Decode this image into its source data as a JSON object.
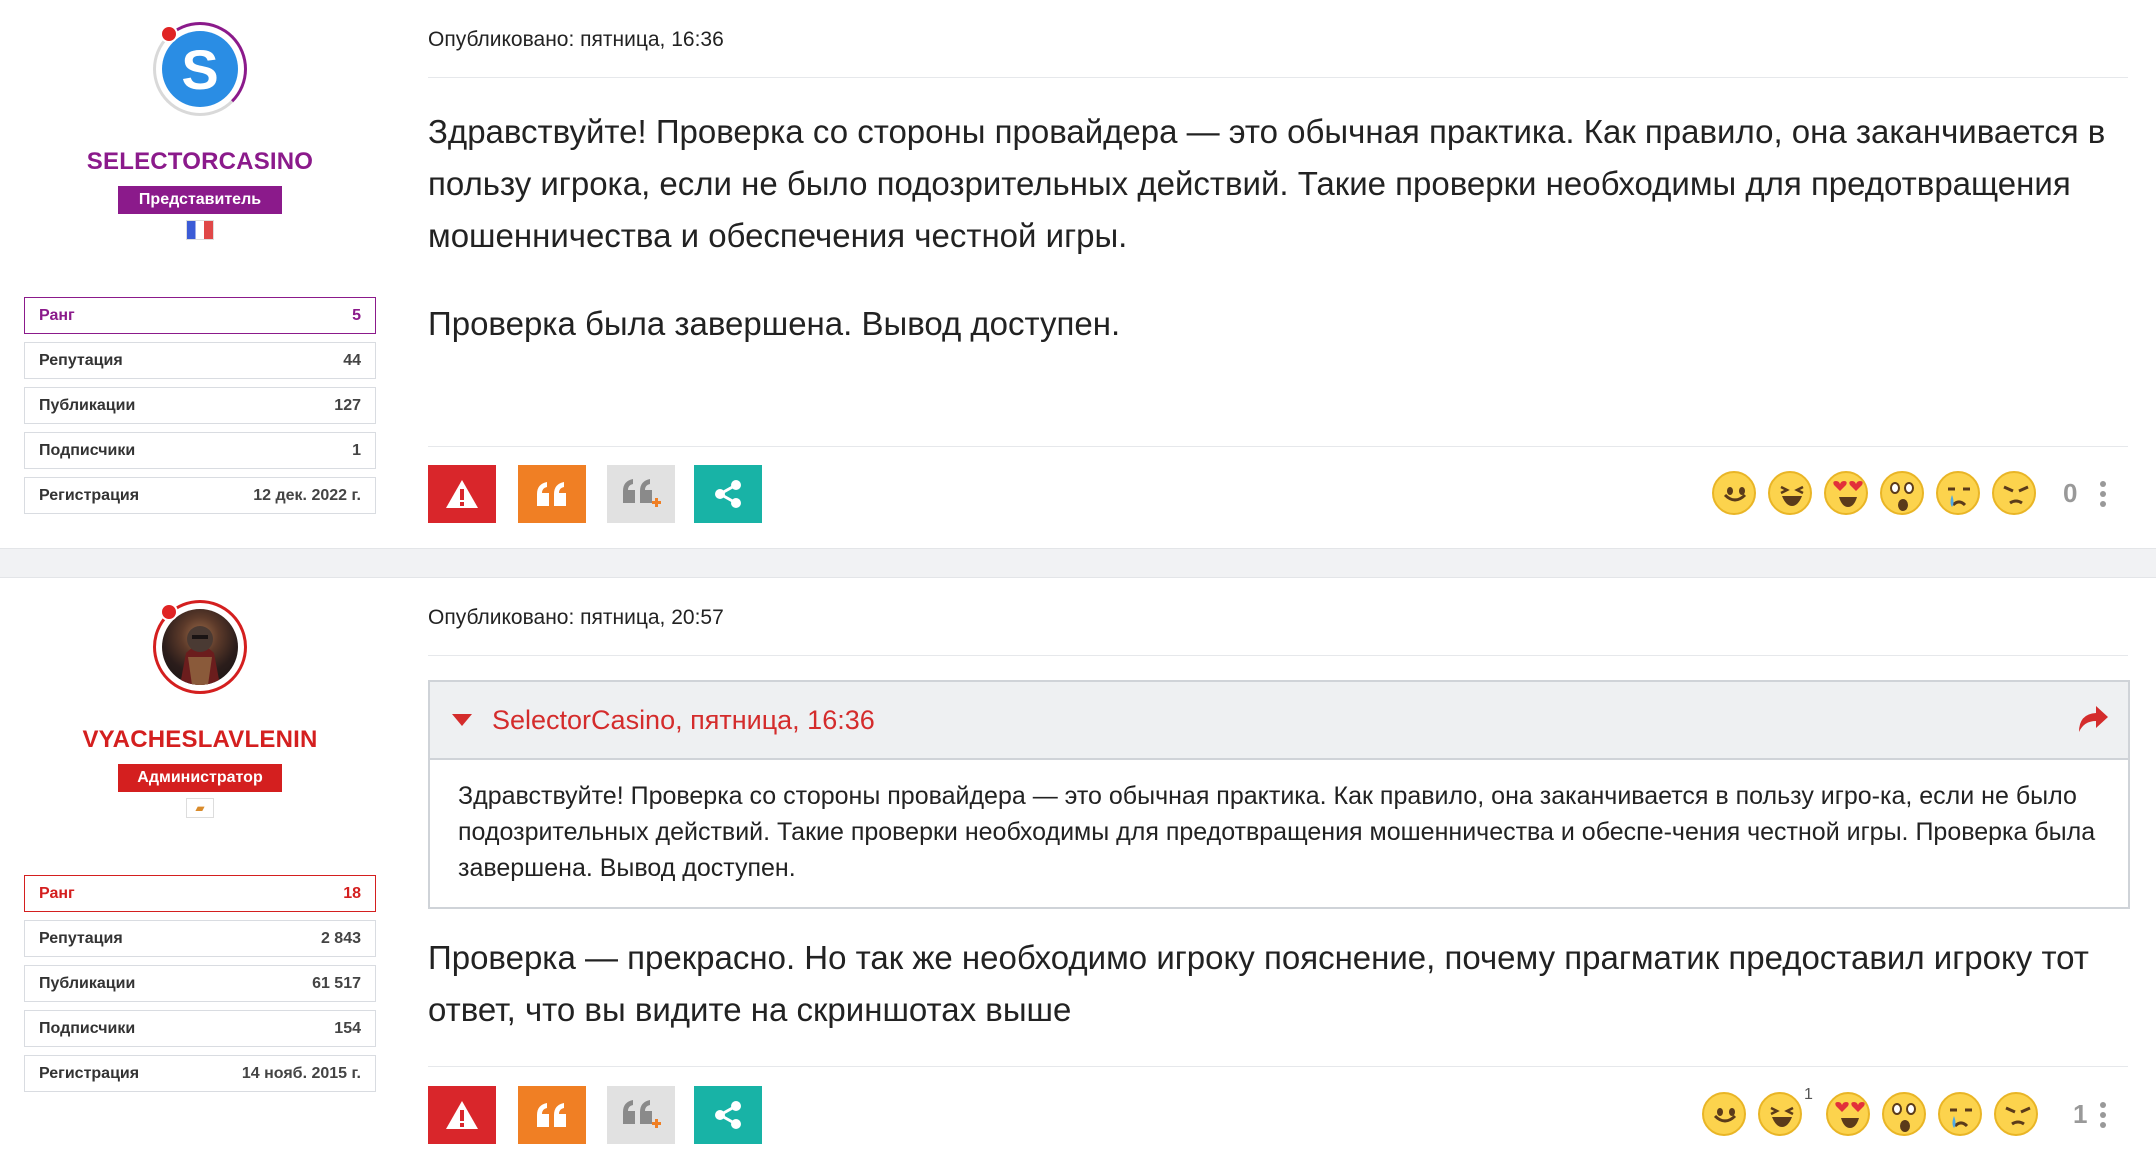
{
  "colors": {
    "representative": "#8b1a8b",
    "admin": "#d41f1f",
    "report": "#d9262b",
    "quote": "#f07f24",
    "multiquote": "#e1e1e1",
    "share": "#18b3a6"
  },
  "posts": [
    {
      "posted_label": "Опубликовано: пятница, 16:36",
      "author": {
        "avatar_letter": "S",
        "name": "SELECTORCASINO",
        "role": "Представитель",
        "flag_icon": "france-flag-icon",
        "stats": [
          {
            "label": "Ранг",
            "value": "5"
          },
          {
            "label": "Репутация",
            "value": "44"
          },
          {
            "label": "Публикации",
            "value": "127"
          },
          {
            "label": "Подписчики",
            "value": "1"
          },
          {
            "label": "Регистрация",
            "value": "12 дек. 2022 г."
          }
        ]
      },
      "paragraphs": [
        "Здравствуйте! Проверка со стороны провайдера — это обычная практика. Как правило, она заканчивается в пользу игрока, если не было подозрительных действий. Такие проверки необходимы для предотвращения мошенничества и обеспечения честной игры.",
        "Проверка была завершена. Вывод доступен."
      ],
      "reaction_count": "0"
    },
    {
      "posted_label": "Опубликовано: пятница, 20:57",
      "author": {
        "name": "VYACHESLAVLENIN",
        "role": "Администратор",
        "flag_icon": "cyprus-flag-icon",
        "stats": [
          {
            "label": "Ранг",
            "value": "18"
          },
          {
            "label": "Репутация",
            "value": "2 843"
          },
          {
            "label": "Публикации",
            "value": "61 517"
          },
          {
            "label": "Подписчики",
            "value": "154"
          },
          {
            "label": "Регистрация",
            "value": "14 нояб. 2015 г."
          }
        ]
      },
      "quote": {
        "title": "SelectorCasino, пятница, 16:36",
        "text": "Здравствуйте! Проверка со стороны провайдера — это обычная практика. Как правило, она заканчивается в пользу игро-ка, если не было подозрительных действий. Такие проверки необходимы для предотвращения мошенничества и обеспе-чения честной игры. Проверка была завершена. Вывод доступен."
      },
      "paragraphs": [
        "Проверка — прекрасно. Но так же необходимо игроку пояснение, почему прагматик предоставил игроку тот ответ, что вы видите на скриншотах выше"
      ],
      "laugh_count": "1",
      "reaction_count": "1"
    }
  ]
}
